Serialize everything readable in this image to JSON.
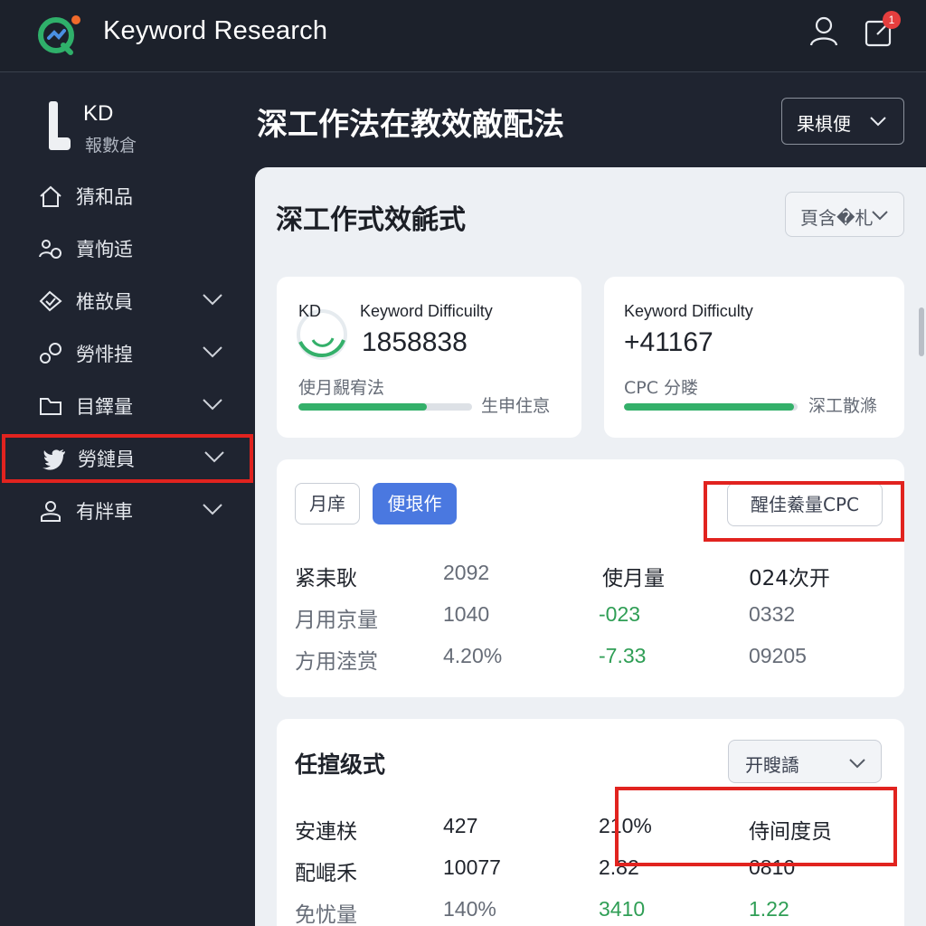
{
  "app": {
    "title": "Keyword Research",
    "notification_count": "1"
  },
  "sidebar": {
    "user_title": "KD",
    "user_subtitle": "報數倉",
    "items": [
      {
        "label": "猜和品",
        "icon": "home-icon",
        "has_chevron": false
      },
      {
        "label": "賣恂适",
        "icon": "people-icon",
        "has_chevron": false
      },
      {
        "label": "椎敨員",
        "icon": "tag-icon",
        "has_chevron": true
      },
      {
        "label": "勞悱揘",
        "icon": "link-icon",
        "has_chevron": true
      },
      {
        "label": "目鐸量",
        "icon": "folder-icon",
        "has_chevron": true
      },
      {
        "label": "勞鏈員",
        "icon": "twitter-icon",
        "has_chevron": true,
        "highlighted": true
      },
      {
        "label": "有牉車",
        "icon": "user-icon",
        "has_chevron": true
      }
    ]
  },
  "header": {
    "page_title": "深工作法在教效敵配法",
    "select_label": "果椇便"
  },
  "panel": {
    "title": "深工作式效毹式",
    "select_label": "頁含�札"
  },
  "metric_cards": [
    {
      "badge": "KD",
      "label": "Keyword Difficuilty",
      "value": "1858838",
      "sub_label": "使月覶宥法",
      "side_label": "生申住恴",
      "progress": 0.74
    },
    {
      "label": "Keyword Difficulty",
      "value": "+41167",
      "sub_label": "CPC 分䁖",
      "side_label": "深工散滌",
      "progress": 0.98
    }
  ],
  "table1": {
    "tabs": [
      {
        "label": "月庠",
        "active": false
      },
      {
        "label": "便垠作",
        "active": true
      }
    ],
    "action_label": "醒佳鯗量CPC",
    "rows": [
      [
        "紧耒耿",
        "2092",
        "使月量",
        "024次开"
      ],
      [
        "月用京量",
        "1040",
        "-023",
        "0332"
      ],
      [
        "方用淕赏",
        "4.20%",
        "-7.33",
        "09205"
      ]
    ]
  },
  "table2": {
    "title": "任揎级式",
    "select_label": "开瞍譑",
    "rows": [
      [
        "安連栚",
        "427",
        "210%",
        "侍间度员"
      ],
      [
        "配崐禾",
        "10077",
        "2.82",
        "0810"
      ],
      [
        "免忧量",
        "140%",
        "3410",
        "1.22"
      ]
    ]
  },
  "colors": {
    "accent_green": "#34b06a",
    "primary_blue": "#4a78e0",
    "highlight_red": "#e1231f",
    "sidebar_bg": "#1f2430"
  }
}
